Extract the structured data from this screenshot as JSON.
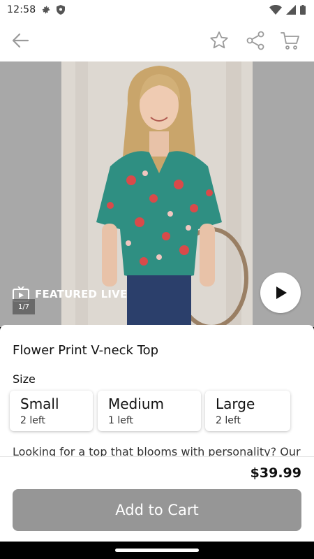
{
  "status": {
    "time": "12:58"
  },
  "product": {
    "title": "Flower Print V-neck Top",
    "price": "$39.99",
    "description": "Looking for a top that blooms with personality? Our"
  },
  "media": {
    "badge": "FEATURED LIVE",
    "counter": "1/7"
  },
  "size": {
    "label": "Size",
    "options": [
      {
        "name": "Small",
        "stock": "2 left"
      },
      {
        "name": "Medium",
        "stock": "1 left"
      },
      {
        "name": "Large",
        "stock": "2 left"
      }
    ]
  },
  "actions": {
    "add_to_cart": "Add to Cart"
  },
  "icons": {
    "back": "arrow-left-icon",
    "favorite": "star-outline-icon",
    "share": "share-icon",
    "cart": "cart-icon",
    "play": "play-icon",
    "live": "tv-play-icon"
  },
  "colors": {
    "button_disabled": "#969696",
    "icon_gray": "#9a9a9a",
    "hero_bg": "#a8a8a8"
  }
}
